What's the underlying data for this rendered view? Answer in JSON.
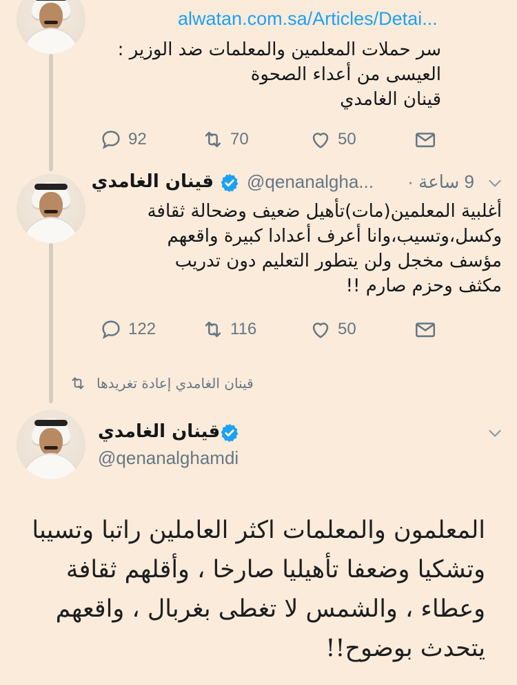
{
  "tweet1": {
    "link": "alwatan.com.sa/Articles/Detai...",
    "lines": [
      "سر حملات المعلمين والمعلمات ضد الوزير :",
      "العيسى من أعداء الصحوة",
      "قينان الغامدي"
    ],
    "replies": "92",
    "retweets": "70",
    "likes": "50"
  },
  "tweet2": {
    "name": "قينان الغامدي",
    "handle": "@qenanalgha...",
    "time": "9 ساعة",
    "separator": "·",
    "lines": [
      "أغلبية المعلمين(مات)تأهيل ضعيف وضحالة ثقافة",
      "وكسل،وتسيب،وانا أعرف أعدادا كبيرة واقعهم",
      "مؤسف مخجل ولن يتطور التعليم دون تدريب",
      "مكثف وحزم صارم !!"
    ],
    "replies": "122",
    "retweets": "116",
    "likes": "50"
  },
  "retweet_note": "قينان الغامدي إعادة تغريدها",
  "tweet3": {
    "name": "قينان الغامدي",
    "handle": "@qenanalghamdi",
    "lines": [
      "المعلمون والمعلمات اكثر العاملين راتبا وتسيبا",
      "وتشكيا وضعفا تأهيليا صارخا ، وأقلهم ثقافة",
      "وعطاء ، والشمس لا تغطى بغربال ، واقعهم",
      "يتحدث بوضوح!!"
    ]
  },
  "colors": {
    "background": "#fbebda",
    "link": "#1da1f2",
    "verified": "#1da1f2",
    "muted": "#657786"
  },
  "icons": [
    "reply-icon",
    "retweet-icon",
    "like-icon",
    "dm-icon",
    "verified-icon",
    "chevron-down-icon"
  ]
}
